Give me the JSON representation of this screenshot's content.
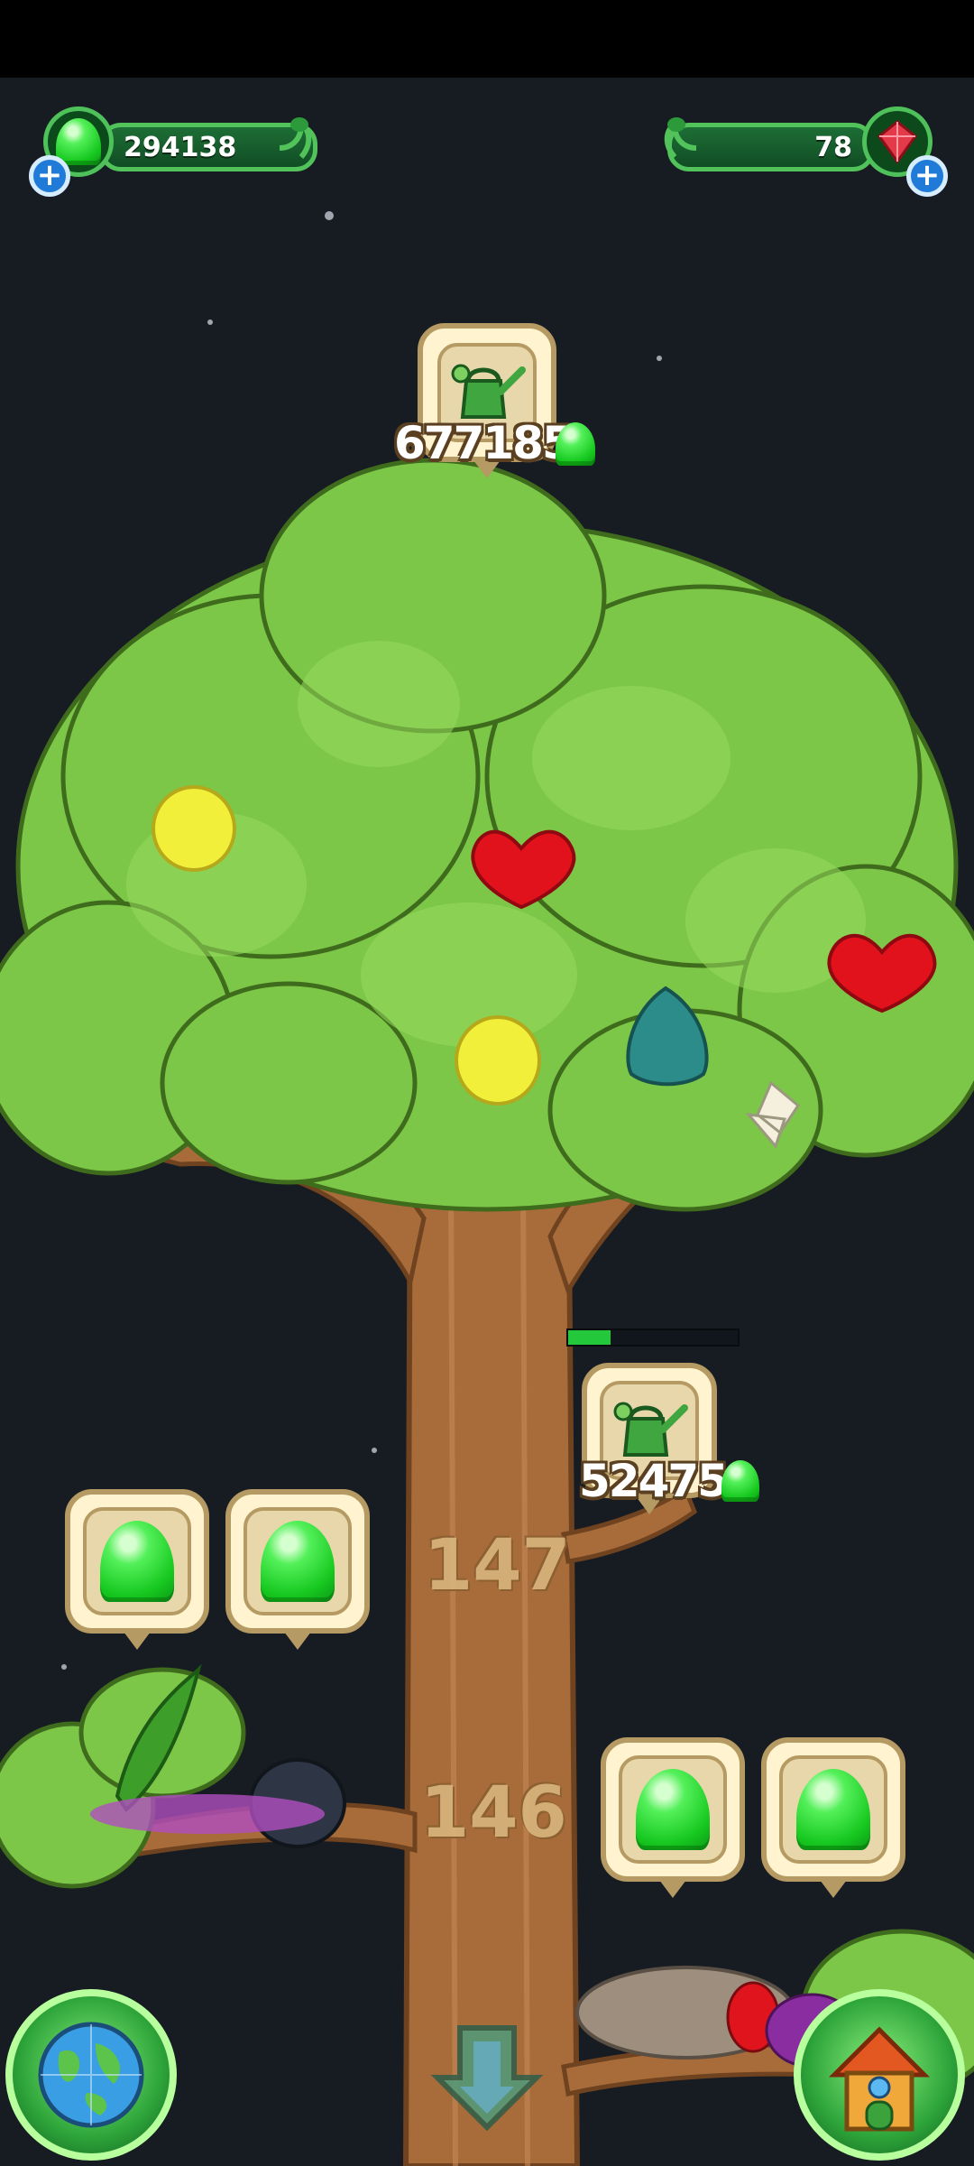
{
  "resources": {
    "gumdrops": {
      "value": "294138",
      "icon": "gumdrop-icon",
      "color": "#22d12b"
    },
    "gems": {
      "value": "78",
      "icon": "red-gem-icon",
      "color": "#e23a48"
    }
  },
  "upgrades": [
    {
      "icon": "watering-can-icon",
      "cost": "677185",
      "currency_icon": "gumdrop-icon"
    },
    {
      "icon": "watering-can-icon",
      "cost": "52475",
      "currency_icon": "gumdrop-icon",
      "progress": 0.25
    }
  ],
  "levels": [
    "147",
    "146"
  ],
  "collectibles": [
    "gumdrop-icon",
    "gumdrop-icon",
    "gumdrop-icon",
    "gumdrop-icon"
  ],
  "fruits": [
    "yellow-fruit",
    "red-heart-fruit",
    "red-heart-fruit",
    "yellow-fruit",
    "teal-seed-pod",
    "white-flower"
  ],
  "buttons": {
    "world": "globe-icon",
    "scroll_down": "arrow-down-icon",
    "home": "house-icon"
  },
  "colors": {
    "background": "#171b22",
    "leaf": "#7cc648",
    "trunk": "#a86b3a"
  }
}
